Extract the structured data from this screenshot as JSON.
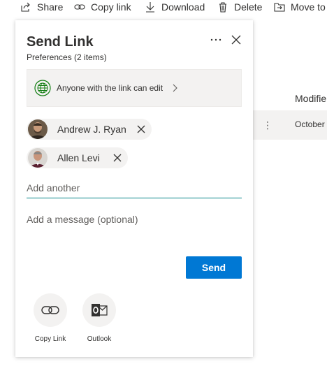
{
  "command_bar": {
    "share": "Share",
    "copy_link": "Copy link",
    "download": "Download",
    "delete": "Delete",
    "move_to": "Move to"
  },
  "background_list": {
    "column_header": "Modifie",
    "row_date": "October"
  },
  "send_link": {
    "title": "Send Link",
    "subtitle": "Preferences (2 items)",
    "permission": "Anyone with the link can edit",
    "recipients": [
      {
        "name": "Andrew J. Ryan"
      },
      {
        "name": "Allen Levi"
      }
    ],
    "add_another_placeholder": "Add another",
    "message_placeholder": "Add a message (optional)",
    "send_label": "Send",
    "share_options": [
      {
        "label": "Copy Link",
        "icon": "link-icon"
      },
      {
        "label": "Outlook",
        "icon": "outlook-icon"
      }
    ]
  },
  "colors": {
    "accent": "#0078d4",
    "input_underline": "#038387",
    "permission_icon": "#107c10",
    "chip_background": "#f3f2f1"
  }
}
